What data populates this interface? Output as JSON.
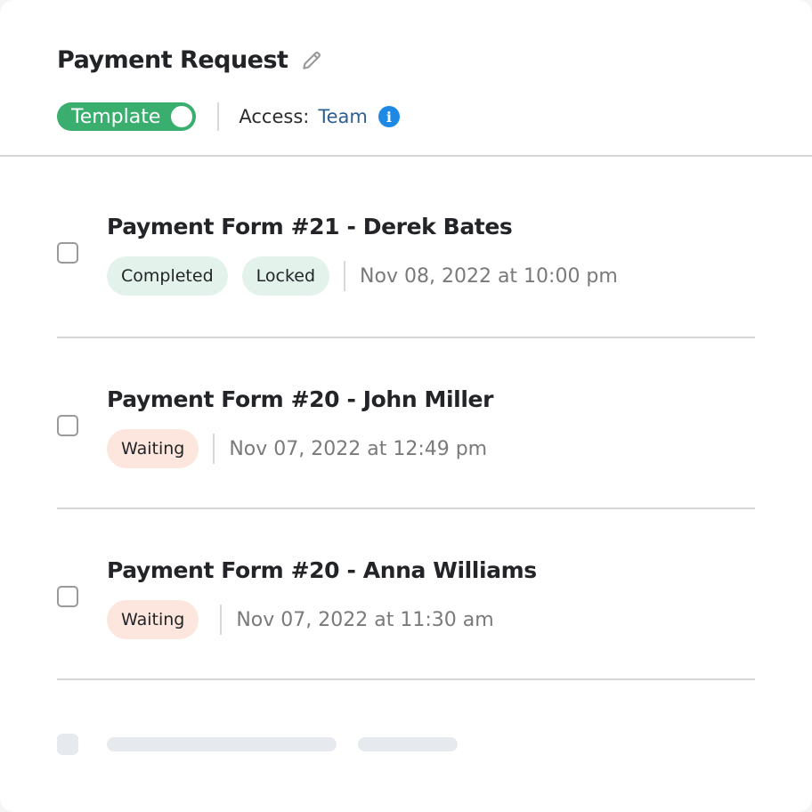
{
  "header": {
    "title": "Payment Request",
    "edit_icon": "pencil-icon",
    "template_toggle": {
      "label": "Template",
      "on": true,
      "color": "#3aae6e"
    },
    "access": {
      "label": "Access:",
      "value": "Team",
      "info_icon": "info-icon"
    }
  },
  "forms": [
    {
      "title": "Payment Form #21 - Derek Bates",
      "badges": [
        {
          "label": "Completed",
          "tone": "green"
        },
        {
          "label": "Locked",
          "tone": "green"
        }
      ],
      "date": "Nov 08, 2022 at 10:00 pm",
      "checked": false
    },
    {
      "title": "Payment Form #20 - John Miller",
      "badges": [
        {
          "label": "Waiting",
          "tone": "peach"
        }
      ],
      "date": "Nov 07, 2022 at 12:49 pm",
      "checked": false
    },
    {
      "title": "Payment Form #20 - Anna Williams",
      "badges": [
        {
          "label": "Waiting",
          "tone": "peach"
        }
      ],
      "date": "Nov 07, 2022 at 11:30 am",
      "checked": false
    }
  ],
  "colors": {
    "toggle_on": "#3aae6e",
    "access_link": "#2f5f8f",
    "info": "#1e88e5",
    "badge_green": "#e3f3ec",
    "badge_peach": "#fde6de"
  }
}
